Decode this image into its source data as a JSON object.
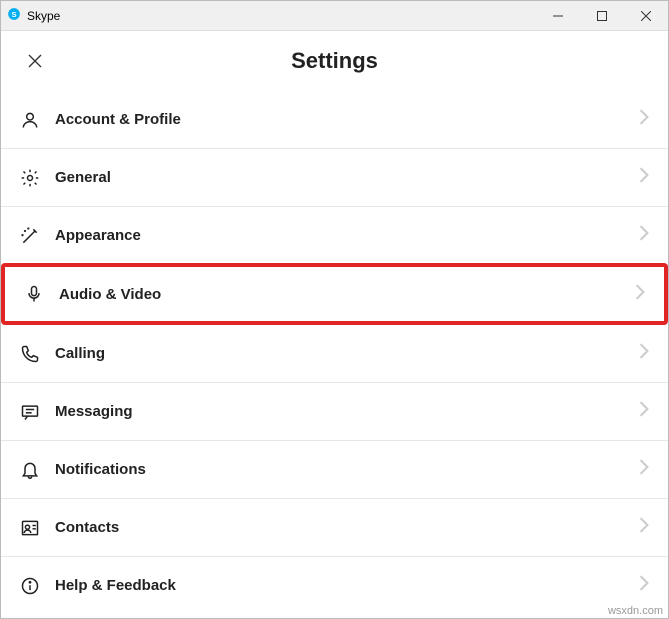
{
  "window": {
    "title": "Skype"
  },
  "header": {
    "title": "Settings"
  },
  "settings": {
    "items": [
      {
        "label": "Account & Profile"
      },
      {
        "label": "General"
      },
      {
        "label": "Appearance"
      },
      {
        "label": "Audio & Video"
      },
      {
        "label": "Calling"
      },
      {
        "label": "Messaging"
      },
      {
        "label": "Notifications"
      },
      {
        "label": "Contacts"
      },
      {
        "label": "Help & Feedback"
      }
    ]
  },
  "watermark": "wsxdn.com"
}
